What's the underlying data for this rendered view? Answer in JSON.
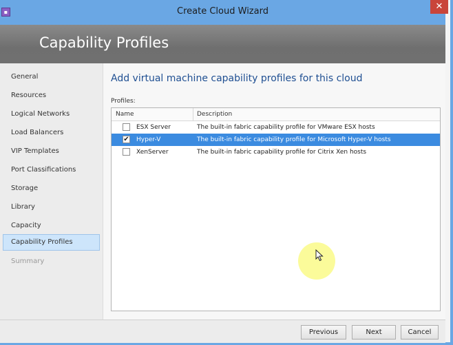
{
  "window": {
    "title": "Create Cloud Wizard",
    "close_glyph": "✕",
    "icon": "app-icon"
  },
  "banner": {
    "title": "Capability Profiles"
  },
  "nav": {
    "items": [
      {
        "label": "General"
      },
      {
        "label": "Resources"
      },
      {
        "label": "Logical Networks"
      },
      {
        "label": "Load Balancers"
      },
      {
        "label": "VIP Templates"
      },
      {
        "label": "Port Classifications"
      },
      {
        "label": "Storage"
      },
      {
        "label": "Library"
      },
      {
        "label": "Capacity"
      },
      {
        "label": "Capability Profiles",
        "selected": true
      },
      {
        "label": "Summary",
        "disabled": true
      }
    ]
  },
  "main": {
    "heading": "Add virtual machine capability profiles for this cloud",
    "profiles_label": "Profiles:",
    "columns": [
      "Name",
      "Description"
    ],
    "rows": [
      {
        "name": "ESX Server",
        "description": "The built-in fabric capability profile for VMware ESX hosts",
        "checked": false
      },
      {
        "name": "Hyper-V",
        "description": "The built-in fabric capability profile for Microsoft Hyper-V hosts",
        "checked": true
      },
      {
        "name": "XenServer",
        "description": "The built-in fabric capability profile for Citrix Xen hosts",
        "checked": false
      }
    ],
    "checkmark": "✔"
  },
  "footer": {
    "previous": "Previous",
    "next": "Next",
    "cancel": "Cancel"
  },
  "colors": {
    "titlebar": "#6aa7e4",
    "banner": "#7a7a7a",
    "selection": "#3b8be0",
    "heading": "#1f4f92",
    "close": "#c9453a"
  }
}
